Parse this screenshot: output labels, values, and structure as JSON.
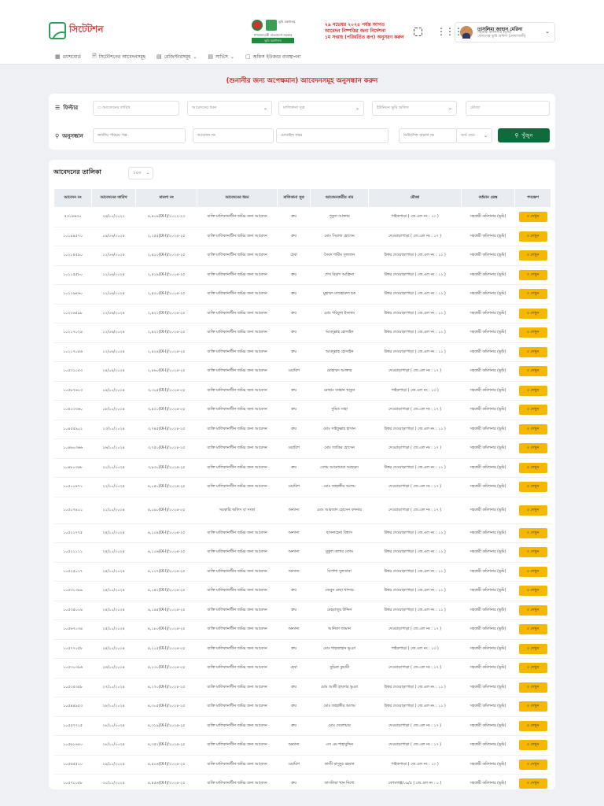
{
  "header": {
    "logo_text": "সিটেটশন",
    "emblem_caption": "ভূমি মন্ত্রণালয়",
    "emblem_subcaption": "গণপ্রজাতন্ত্রী বাংলাদেশ সরকার",
    "emblem_strip": "ভূমি মন্ত্রণালয়",
    "notice_lines": [
      "২৯ নভেম্বর ২০২৪ পর্যন্ত আগত",
      "আবেদন নিষ্পত্তির জন্য নির্দেশনা",
      "১ম সপ্তাহ (পরিবর্তিত রূপ) অনুসরণ করুন"
    ],
    "user_name": "তাসলিমা জাহান মেরিনা",
    "user_role_1": "সহকারী কমিশনার (ভূমি)",
    "user_role_2": "বেগমগঞ্জ ভূমি অফিস (নোয়াখালী)"
  },
  "nav": [
    {
      "icon": "dashboard-icon",
      "glyph": "▦",
      "label": "ড্যাশবোর্ড",
      "has_chevron": false
    },
    {
      "icon": "document-icon",
      "glyph": "🗎",
      "label": "সিটেটশনের আবেদনসমূহ",
      "has_chevron": false
    },
    {
      "icon": "register-icon",
      "glyph": "▤",
      "label": "রেজিস্টারসমূহ",
      "has_chevron": true
    },
    {
      "icon": "report-icon",
      "glyph": "▤",
      "label": "সার্ভিস",
      "has_chevron": true
    },
    {
      "icon": "office-icon",
      "glyph": "▢",
      "label": "অফিস ইউজার ব্যবস্থাপনা",
      "has_chevron": false
    }
  ],
  "page_title": "(শুনানীর জন্য অপেক্ষমান) আবেদনসমূহ অনুসন্ধান করুন",
  "filter": {
    "label": "ফিল্টার",
    "date_placeholder": "আবেদনের তারিখ",
    "type_placeholder": "আবেদনের ধরন",
    "source_placeholder": "মালিকানা সূত্র",
    "office_placeholder": "ইউনিয়ন ভূমি অফিস",
    "mouza_placeholder": "মৌজা"
  },
  "search": {
    "label": "অনুসন্ধান",
    "nid_placeholder": "জাতীয় পরিচয় পত্র",
    "app_no_placeholder": "আবেদন নং",
    "mobile_placeholder": "মোবাইল নম্বর",
    "case_no_placeholder": "মিউটেশন মামলা নং",
    "year_placeholder": "অর্থ বছর",
    "button_label": "খুঁজুন"
  },
  "list": {
    "title": "আবেদনের তালিকা",
    "page_size": "১০০",
    "columns": [
      "আবেদন নং",
      "আবেদনের তারিখ",
      "মামলা নং",
      "আবেদনের ধরন",
      "মালিকানা সূত্র",
      "আবেদনকারীর নাম",
      "মৌজা",
      "বর্তমান ডেস্ক",
      "পদক্ষেপ"
    ],
    "view_label": "৩ দেখুন",
    "rows": [
      [
        "৫৩১৪৬৩০",
        "২৬/১০/২০২২",
        "৪,৪০৯(IX-I)/২০২২-২৩",
        "ব্যক্তি মালিকানাধীন জমির জন্য আবেদন",
        "ক্রয়",
        "পুতুল আক্তার",
        "পাইকপাড়া ( জে.এল নং : ১৩ )",
        "সহকারী কমিশনার (ভূমি)"
      ],
      [
        "১০১৯৪৫৭০",
        "০৯/০৬/২০২৪",
        "২,২৫৫(IX-I)/২০২৪-২৫",
        "ব্যক্তি মালিকানাধীন জমির জন্য আবেদন",
        "ক্রয়",
        "মোঃ সিরাজ হোসেন",
        "দেওয়াড়াপাড়া ( জে.এল নং : ১৭ )",
        "সহকারী কমিশনার (ভূমি)"
      ],
      [
        "১০২১৪৫৯০",
        "১২/০৬/২০২৪",
        "২,৪১০(IX-I)/২০২৪-২৫",
        "ব্যক্তি মালিকানাধীন জমির জন্য আবেদন",
        "হেবা",
        "সৈয়দ শামীম সুলতান",
        "উত্তর দেওয়াড়াপাড়া ( জে.এল নং : ১১ )",
        "সহকারী কমিশনার (ভূমি)"
      ],
      [
        "১০২১৫৫৮০",
        "১২/০৬/২০২৪",
        "২,৪১৯(IX-I)/২০২৪-২৫",
        "ব্যক্তি মালিকানাধীন জমির জন্য আবেদন",
        "ক্রয়",
        "শেখ রিয়াদ আফ্রিনা",
        "উত্তর দেওয়াড়াপাড়া ( জে.এল নং : ১১ )",
        "সহকারী কমিশনার (ভূমি)"
      ],
      [
        "১০২১৬৪৬০",
        "১২/০৬/২০২৪",
        "২,৪২০(IX-I)/২০২৪-২৫",
        "ব্যক্তি মালিকানাধীন জমির জন্য আবেদন",
        "ক্রয়",
        "মুহাম্মদ মাজহারুল হক",
        "উত্তর দেওয়াড়াপাড়া ( জে.এল নং : ১১ )",
        "সহকারী কমিশনার (ভূমি)"
      ],
      [
        "১০২১৬৫৯৮",
        "১২/০৬/২০২৪",
        "২,৪২১(IX-I)/২০২৪-২৫",
        "ব্যক্তি মালিকানাধীন জমির জন্য আবেদন",
        "ক্রয়",
        "মোঃ শরিফুল ইসলাম",
        "উত্তর দেওয়াড়াপাড়া ( জে.এল নং : ১১ )",
        "সহকারী কমিশনার (ভূমি)"
      ],
      [
        "১০২১৭০২৪",
        "১২/০৬/২০২৪",
        "২,৪২২(IX-I)/২০২৪-২৫",
        "ব্যক্তি মালিকানাধীন জমির জন্য আবেদন",
        "ক্রয়",
        "আবদুল্লাহ হোসাইন",
        "উত্তর দেওয়াড়াপাড়া ( জে.এল নং : ১১ )",
        "সহকারী কমিশনার (ভূমি)"
      ],
      [
        "১০২১৭০৫৬",
        "১২/০৬/২০২৪",
        "২,৪২৪(IX-I)/২০২৪-২৫",
        "ব্যক্তি মালিকানাধীন জমির জন্য আবেদন",
        "ক্রয়",
        "আবদুল্লাহ হোসাইন",
        "উত্তর দেওয়াড়াপাড়া ( জে.এল নং : ১১ )",
        "সহকারী কমিশনার (ভূমি)"
      ],
      [
        "১০৫৩১০৫৩",
        "২৪/০৯/২০২৪",
        "২,৮৬০(IX-I)/২০২৪-২৫",
        "ব্যক্তি মালিকানাধীন জমির জন্য আবেদন",
        "ওয়ারিশ",
        "মোহাম্মদ আক্তার",
        "দেওয়াড়াপাড়া ( জে.এল নং : ১৭ )",
        "সহকারী কমিশনার (ভূমি)"
      ],
      [
        "১০৫৮৭৬০৩",
        "০৯/১০/২০২৪",
        "৩,৩০৫(IX-I)/২০২৪-২৫",
        "ব্যক্তি মালিকানাধীন জমির জন্য আবেদন",
        "ক্রয়",
        "মোছাঃ জাহান খাতুন",
        "পাইকপাড়া ( জে.এল নং : ১৩ )",
        "সহকারী কমিশনার (ভূমি)"
      ],
      [
        "১০৪০৩৩৬০",
        "০৮/১০/২০২৪",
        "৩,৪২০(IX-I)/২০২৪-২৫",
        "ব্যক্তি মালিকানাধীন জমির জন্য আবেদন",
        "ক্রয়",
        "সুমিত সাহা",
        "দেওয়াড়াপাড়া ( জে.এল নং : ১৭ )",
        "সহকারী কমিশনার (ভূমি)"
      ],
      [
        "১০৪৫৫৯০২",
        "১৩/১০/২০২৪",
        "৩,৭৪৫(IX-I)/২০২৪-২৫",
        "ব্যক্তি মালিকানাধীন জমির জন্য আবেদন",
        "ক্রয়",
        "মোঃ সাইফুল্লাহ হাসান",
        "উত্তর দেওয়াড়াপাড়া ( জে.এল নং : ১১ )",
        "সহকারী কমিশনার (ভূমি)"
      ],
      [
        "১০৪৬০৩৬৬",
        "১৬/১০/২০২৪",
        "৩,৭৫০(IX-I)/২০২৪-২৫",
        "ব্যক্তি মালিকানাধীন জমির জন্য আবেদন",
        "ওয়ারিশ",
        "মোঃ জাকির হোসেন",
        "দেওয়াড়াপাড়া ( জে.এল নং : ১৭ )",
        "সহকারী কমিশনার (ভূমি)"
      ],
      [
        "১০৪৮০৩৬৮",
        "২০/১০/২০২৪",
        "৩,৮৩০(IX-I)/২০২৪-২৫",
        "ব্যক্তি মালিকানাধীন জমির জন্য আবেদন",
        "ক্রয়",
        "বেগম আনোয়ারা আহমেদ",
        "উত্তর দেওয়াড়াপাড়া ( জে.এল নং : ১১ )",
        "সহকারী কমিশনার (ভূমি)"
      ],
      [
        "১০৫০০৪৭১",
        "২২/১০/২০২৪",
        "৪,০৫০(IX-I)/২০২৪-২৫",
        "ব্যক্তি মালিকানাধীন জমির জন্য আবেদন",
        "ওয়ারিশ",
        "মোঃ জাহাঙ্গীর আলম",
        "দেওয়াড়াপাড়া ( জে.এল নং : ১৭ )",
        "সহকারী কমিশনার (ভূমি)"
      ],
      [
        "১০৫০৭৪০১",
        "২১/১০/২০২৪",
        "৪,০৯০(IX-I)/২০২৪-২৫",
        "সরকারি অফিস বা সংস্থা",
        "অন্যান্য",
        "মোঃ আরজাদ হোসেন বন্দনার",
        "দেওয়াড়াপাড়া ( জে.এল নং : ১৭ )",
        "সহকারী কমিশনার (ভূমি)"
      ],
      [
        "১০৫২১৭৭৫",
        "২৪/১০/২০২৪",
        "৪,১০৪(IX-I)/২০২৪-২৫",
        "ব্যক্তি মালিকানাধীন জমির জন্য আবেদন",
        "অন্যান্য",
        "হাসনাহেনা বিশ্বাস",
        "উত্তর দেওয়াড়াপাড়া ( জে.এল নং : ১১ )",
        "সহকারী কমিশনার (ভূমি)"
      ],
      [
        "১০৫২১১১১",
        "২৪/১০/২০২৪",
        "৪,১০৬(IX-I)/২০২৪-২৫",
        "ব্যক্তি মালিকানাধীন জমির জন্য আবেদন",
        "অন্যান্য",
        "মুকুল বালার বেগম",
        "উত্তর দেওয়াড়াপাড়া ( জে.এল নং : ১১ )",
        "সহকারী কমিশনার (ভূমি)"
      ],
      [
        "১০৫২৫০১৭",
        "২৪/১০/২০২৪",
        "৪,১০৭(IX-I)/২০২৪-২৫",
        "ব্যক্তি মালিকানাধীন জমির জন্য আবেদন",
        "অন্যান্য",
        "বিপাশা সুলতানা",
        "উত্তর দেওয়াড়াপাড়া ( জে.এল নং : ১১ )",
        "সহকারী কমিশনার (ভূমি)"
      ],
      [
        "১০৫৩১৩৯৯",
        "২৪/১০/২০২৪",
        "৪,১৪২(IX-I)/২০২৪-২৫",
        "ব্যক্তি মালিকানাধীন জমির জন্য আবেদন",
        "ক্রয়",
        "জেবুন নেছা খান্দার",
        "উত্তর দেওয়াড়াপাড়া ( জে.এল নং : ১১ )",
        "সহকারী কমিশনার (ভূমি)"
      ],
      [
        "১০৫৩৫০০৪",
        "২৪/১০/২০২৪",
        "৪,১৪৫(IX-I)/২০২৪-২৫",
        "ব্যক্তি মালিকানাধীন জমির জন্য আবেদন",
        "ক্রয়",
        "মেহরাজুর উদ্দিন",
        "উত্তর দেওয়াড়াপাড়া ( জে.এল নং : ১১ )",
        "সহকারী কমিশনার (ভূমি)"
      ],
      [
        "১০৫৬৭০৩৪",
        "২৫/১০/২০২৪",
        "৪,১৮০(IX-I)/২০২৪-২৫",
        "ব্যক্তি মালিকানাধীন জমির জন্য আবেদন",
        "অন্যান্য",
        "আনিকা জামান",
        "দেওয়াড়াপাড়া ( জে.এল নং : ১৭ )",
        "সহকারী কমিশনার (ভূমি)"
      ],
      [
        "১০৫৭৭০৫৮",
        "২৪/১০/২০২৪",
        "৪,২১৫(IX-I)/২০২৪-২৫",
        "ব্যক্তি মালিকানাধীন জমির জন্য আবেদন",
        "ক্রয়",
        "মোঃ শাহজাহান ভূঞা",
        "পাইকপাড়া ( জে.এল নং : ১৩ )",
        "সহকারী কমিশনার (ভূমি)"
      ],
      [
        "১০৫৩০৩৯৬",
        "২৬/১০/২০২৪",
        "৪,২৩০(IX-I)/২০২৪-২৫",
        "ব্যক্তি মালিকানাধীন জমির জন্য আবেদন",
        "হেবা",
        "সুচিত্রা কুমারী",
        "দেওয়াড়াপাড়া ( জে.এল নং : ১৭ )",
        "সহকারী কমিশনার (ভূমি)"
      ],
      [
        "১০৫৩৫৩৫৮",
        "২৭/১০/২০২৪",
        "৪,২৭০(IX-I)/২০২৪-২৫",
        "ব্যক্তি মালিকানাধীন জমির জন্য আবেদন",
        "ক্রয়",
        "মোঃ আলী হায়দার ভূঞা",
        "উত্তর দেওয়াড়াপাড়া ( জে.এল নং : ১১ )",
        "সহকারী কমিশনার (ভূমি)"
      ],
      [
        "১০৫৪৪৯৫৩",
        "২৮/১০/২০২৪",
        "৪,৩০৫(IX-I)/২০২৪-২৫",
        "ব্যক্তি মালিকানাধীন জমির জন্য আবেদন",
        "ক্রয়",
        "মোঃ জাহাঙ্গীর আলম",
        "উত্তর দেওয়াড়াপাড়া ( জে.এল নং : ১১ )",
        "সহকারী কমিশনার (ভূমি)"
      ],
      [
        "১০৫৫৭৭২৫",
        "২৮/১০/২০২৪",
        "৪,৩১৯(IX-I)/২০২৪-২৫",
        "ব্যক্তি মালিকানাধীন জমির জন্য আবেদন",
        "ক্রয়",
        "মোঃ দেলোয়ার",
        "দেওয়াড়াপাড়া ( জে.এল নং : ১৭ )",
        "সহকারী কমিশনার (ভূমি)"
      ],
      [
        "১০৫৬১৬৪০",
        "২৮/১০/২০২৪",
        "৪,৩৫২(IX-I)/২০২৪-২৫",
        "ব্যক্তি মালিকানাধীন জমির জন্য আবেদন",
        "অন্যান্য",
        "এস এম শাহাবুদ্দিন",
        "দেওয়াড়াপাড়া ( জে.এল নং : ১৭ )",
        "সহকারী কমিশনার (ভূমি)"
      ],
      [
        "১০৫৬৫৫০০",
        "২৯/১০/২০২৪",
        "৪,৪০৬(IX-I)/২০২৪-২৫",
        "ব্যক্তি মালিকানাধীন জমির জন্য আবেদন",
        "ওয়ারিশ",
        "কাজী মাসুদুর রহমান",
        "পাইকপাড়া ( জে.এল নং : ১৩ )",
        "সহকারী কমিশনার (ভূমি)"
      ],
      [
        "১০৫৭০০৫৮",
        "৩০/১০/২০২৪",
        "৪,৪৫৬(IX-I)/২০২৪-২৫",
        "ব্যক্তি মালিকানাধীন জমির জন্য আবেদন",
        "ক্রয়",
        "তাসলিমা খান নিশো",
        "বেগমগঞ্জ/০৯/৫ ( জে.এল নং : ০ )",
        "সহকারী কমিশনার (ভূমি)"
      ]
    ]
  },
  "colors": {
    "accent_red": "#e02020",
    "primary_green": "#0d6b3c",
    "view_button": "#f5b800"
  }
}
